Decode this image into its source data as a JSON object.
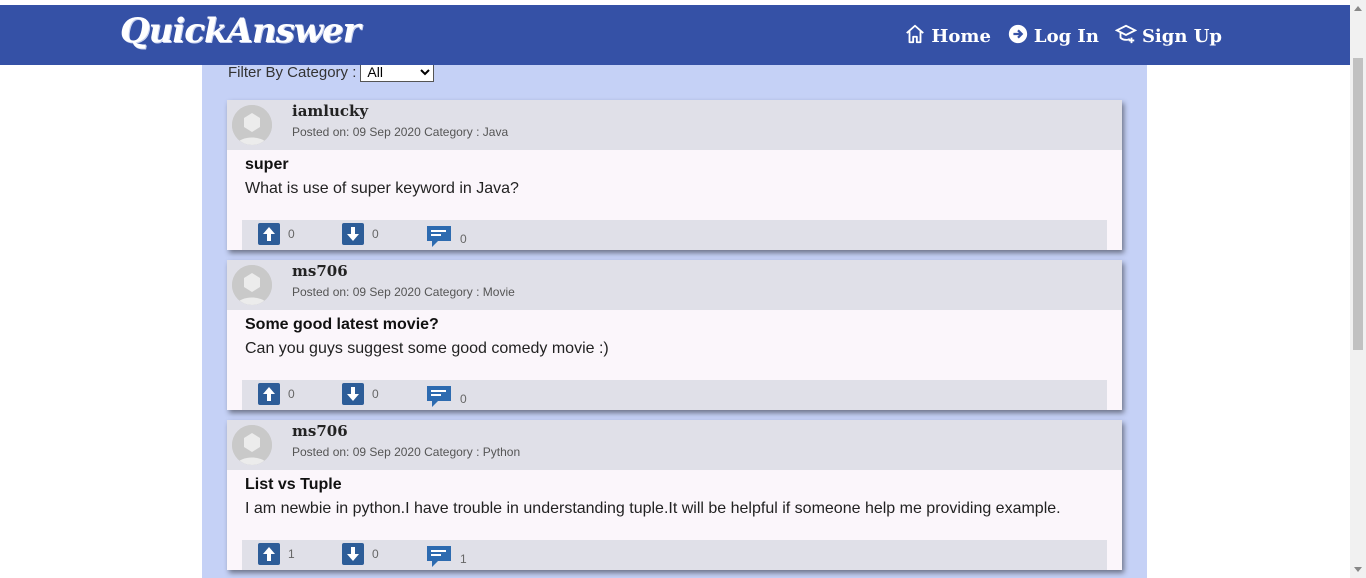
{
  "brand": "QuickAnswer",
  "nav": {
    "home": "Home",
    "login": "Log In",
    "signup": "Sign Up"
  },
  "filter": {
    "label": "Filter By Category :",
    "selected": "All"
  },
  "posts": [
    {
      "username": "iamlucky",
      "meta": "Posted on: 09 Sep 2020 Category : Java",
      "title": "super",
      "body": "What is use of super keyword in Java?",
      "upvotes": "0",
      "downvotes": "0",
      "comments": "0"
    },
    {
      "username": "ms706",
      "meta": "Posted on: 09 Sep 2020 Category : Movie",
      "title": "Some good latest movie?",
      "body": "Can you guys suggest some good comedy movie :)",
      "upvotes": "0",
      "downvotes": "0",
      "comments": "0"
    },
    {
      "username": "ms706",
      "meta": "Posted on: 09 Sep 2020 Category : Python",
      "title": "List vs Tuple",
      "body": "I am newbie in python.I have trouble in understanding tuple.It will be helpful if someone help me providing example.",
      "upvotes": "1",
      "downvotes": "0",
      "comments": "1"
    }
  ],
  "colors": {
    "navbar": "#3551a6",
    "content_bg": "#c5d1f6",
    "card_header": "#e0e0e8",
    "vote_button": "#2d5d98"
  }
}
